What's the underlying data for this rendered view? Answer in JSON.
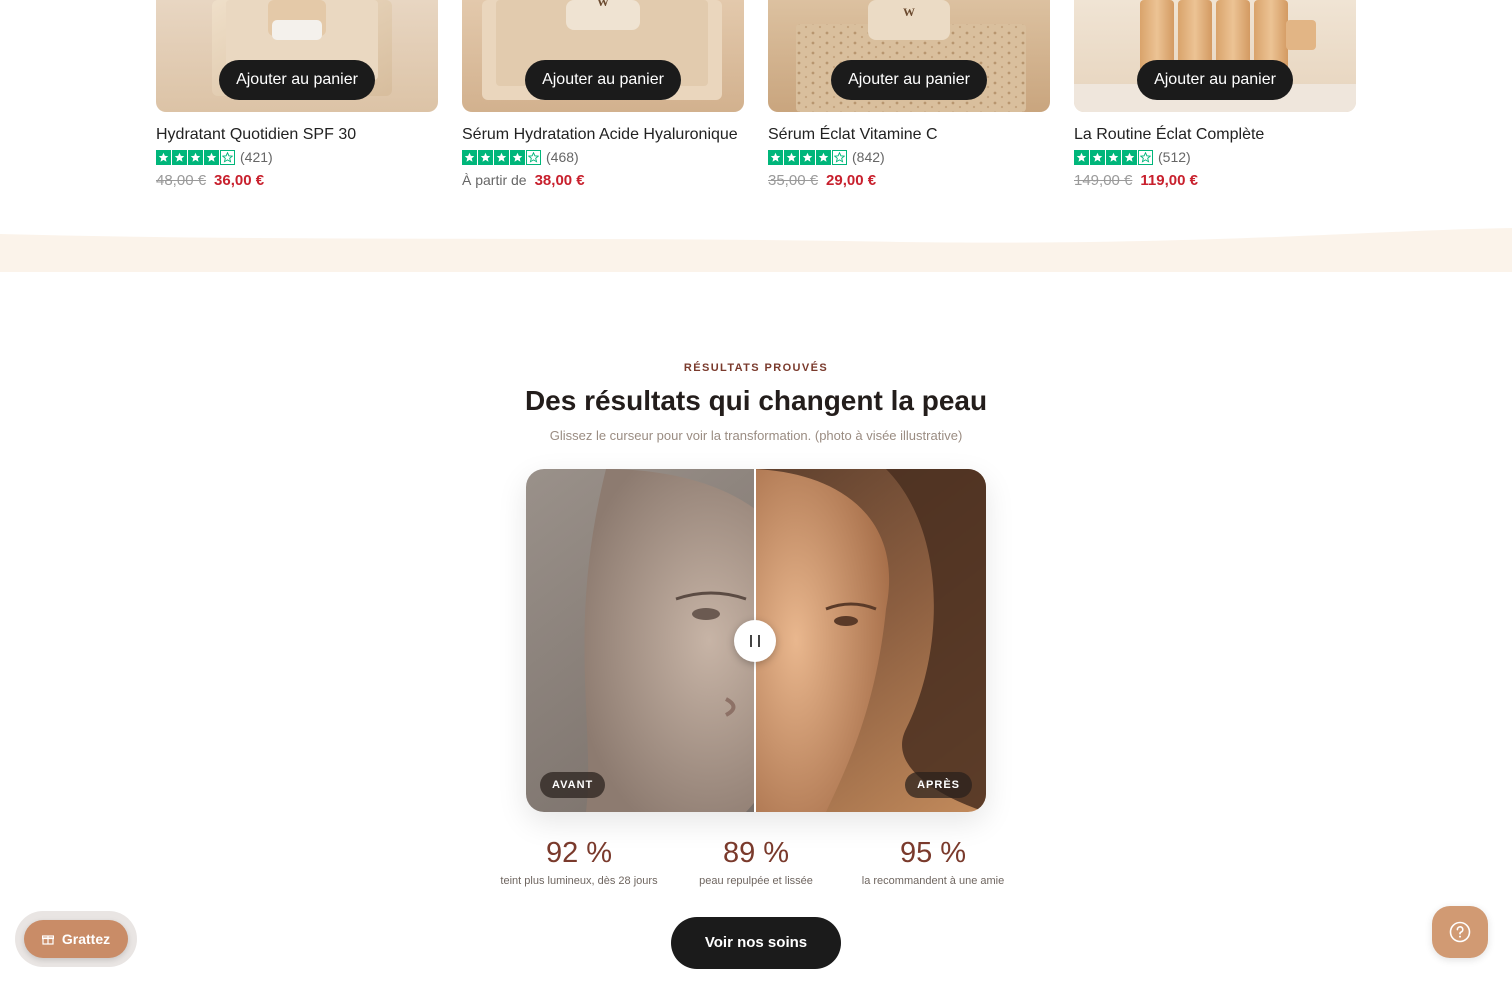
{
  "products": [
    {
      "title": "Hydratant Quotidien SPF 30",
      "rating_count": "(421)",
      "price_old": "48,00 €",
      "price_from": "",
      "price_new": "36,00 €",
      "add_label": "Ajouter au panier"
    },
    {
      "title": "Sérum Hydratation Acide Hyaluronique",
      "rating_count": "(468)",
      "price_old": "",
      "price_from": "À partir de",
      "price_new": "38,00 €",
      "add_label": "Ajouter au panier"
    },
    {
      "title": "Sérum Éclat Vitamine C",
      "rating_count": "(842)",
      "price_old": "35,00 €",
      "price_from": "",
      "price_new": "29,00 €",
      "add_label": "Ajouter au panier"
    },
    {
      "title": "La Routine Éclat Complète",
      "rating_count": "(512)",
      "price_old": "149,00 €",
      "price_from": "",
      "price_new": "119,00 €",
      "add_label": "Ajouter au panier"
    }
  ],
  "rating_stars": 4.5,
  "results": {
    "eyebrow": "RÉSULTATS PROUVÉS",
    "title": "Des résultats qui changent la peau",
    "subtitle": "Glissez le curseur pour voir la transformation. (photo à visée illustrative)",
    "before_label": "AVANT",
    "after_label": "APRÈS",
    "slider_position": 0.5,
    "stats": [
      {
        "value": "92 %",
        "label": "teint plus lumineux, dès 28 jours"
      },
      {
        "value": "89 %",
        "label": "peau repulpée et lissée"
      },
      {
        "value": "95 %",
        "label": "la recommandent à une amie"
      }
    ],
    "cta_label": "Voir nos soins"
  },
  "widgets": {
    "scratch_label": "Grattez",
    "scratch_icon": "gift-icon",
    "help_icon": "question-icon"
  },
  "colors": {
    "accent": "#7a3a2c",
    "sale": "#c8202d",
    "star": "#00b67a",
    "button": "#1b1b1b",
    "widget": "#c98c67",
    "band": "#fbf3ea"
  }
}
